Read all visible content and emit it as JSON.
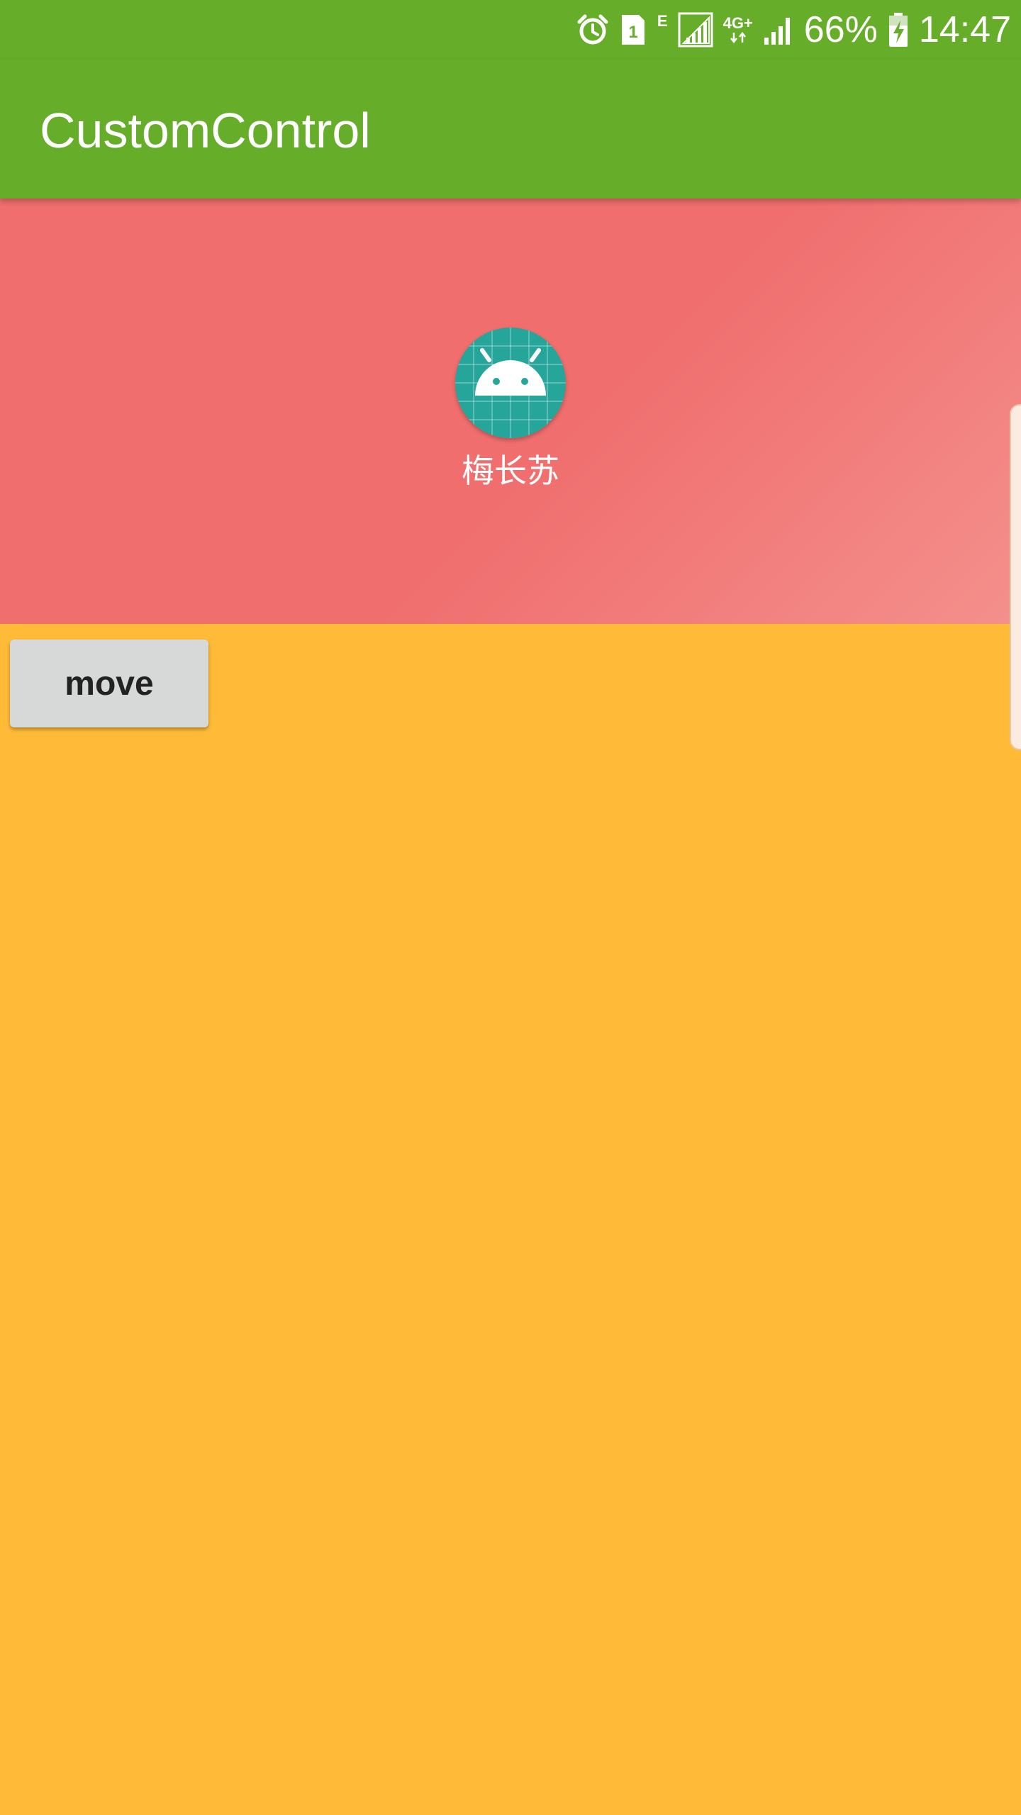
{
  "status_bar": {
    "icons": [
      "alarm-icon",
      "sim1-icon",
      "edge-network-icon",
      "signal-icon",
      "4g-plus-icon",
      "signal-icon",
      "battery-charging-icon"
    ],
    "sim_slot": "1",
    "edge_label": "E",
    "lte_label": "4G+",
    "battery_percent": "66%",
    "time": "14:47"
  },
  "app_bar": {
    "title": "CustomControl"
  },
  "header": {
    "avatar_icon": "android-icon",
    "name": "梅长苏"
  },
  "actions": {
    "move_label": "move"
  },
  "colors": {
    "primary": "#66AE29",
    "header_bg": "#F06E6E",
    "content_bg": "#FFBA37",
    "avatar_bg": "#26A69A",
    "button_bg": "#D7D8D8"
  }
}
